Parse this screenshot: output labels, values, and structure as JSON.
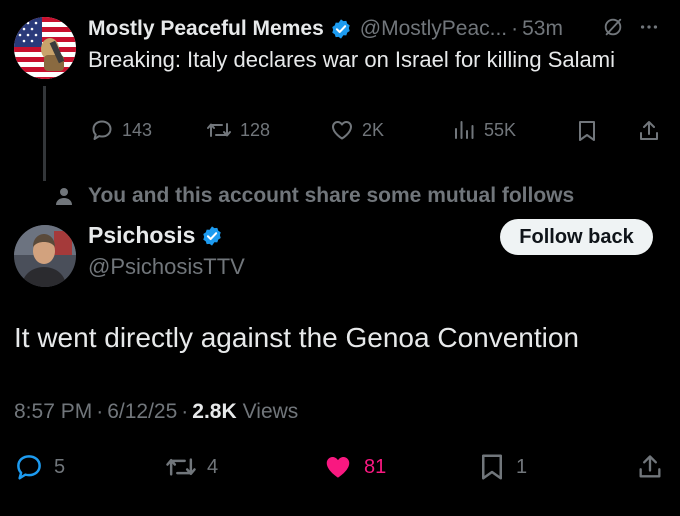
{
  "parent_tweet": {
    "author_name": "Mostly Peaceful Memes",
    "handle": "@MostlyPeac...",
    "separator": "·",
    "time_ago": "53m",
    "text": "Breaking: Italy declares war on Israel for killing Salami",
    "stats": {
      "replies": "143",
      "retweets": "128",
      "likes": "2K",
      "views": "55K"
    }
  },
  "social_context": {
    "text": "You and this account share some mutual follows"
  },
  "reply_tweet": {
    "author_name": "Psichosis",
    "handle": "@PsichosisTTV",
    "follow_button": "Follow back",
    "text": "It went directly against the Genoa Convention",
    "time": "8:57 PM",
    "date": "6/12/25",
    "dot": "·",
    "views_count": "2.8K",
    "views_label": "Views",
    "stats": {
      "replies": "5",
      "retweets": "4",
      "likes": "81",
      "bookmarks": "1"
    }
  },
  "colors": {
    "background": "#000000",
    "text": "#e7e9ea",
    "muted": "#71767b",
    "verified": "#1d9bf0",
    "like_active": "#f91880",
    "button_bg": "#eff3f4"
  },
  "icons": [
    "verified-badge-icon",
    "grok-icon",
    "more-icon",
    "reply-icon",
    "retweet-icon",
    "like-icon",
    "views-icon",
    "bookmark-icon",
    "share-icon",
    "person-icon"
  ]
}
